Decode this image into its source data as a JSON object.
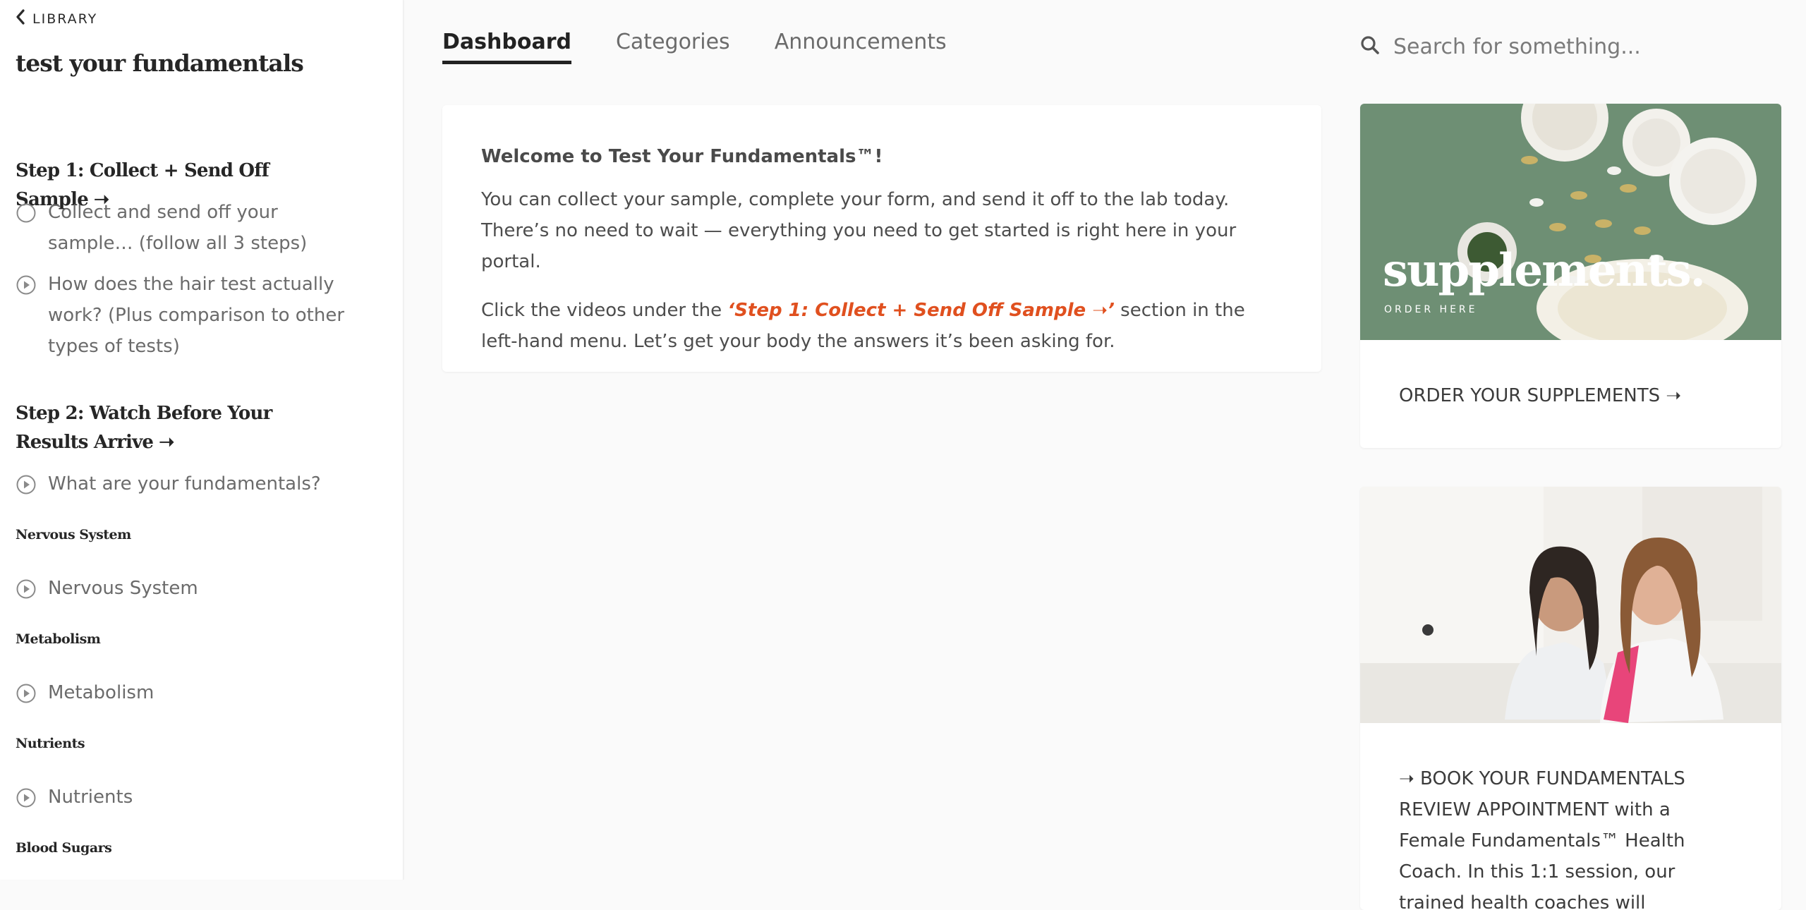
{
  "sidebar": {
    "back_label": "LIBRARY",
    "course_title": "test your fundamentals",
    "step1_title": "Step 1: Collect + Send Off Sample ➝",
    "step1_lessons": [
      {
        "label": "Collect and send off your sample… (follow all 3 steps)",
        "icon": "circle-progress-icon"
      },
      {
        "label": "How does the hair test actually work? (Plus comparison to other types of tests)",
        "icon": "play-circle-icon"
      }
    ],
    "step2_title": "Step 2: Watch Before Your Results Arrive ➝",
    "step2_lessons": [
      {
        "label": "What are your fundamentals?",
        "icon": "play-circle-icon"
      }
    ],
    "nervous_title": "Nervous System",
    "nervous_lesson": "Nervous System",
    "metabolism_title": "Metabolism",
    "metabolism_lesson": "Metabolism",
    "nutrients_title": "Nutrients",
    "nutrients_lesson": "Nutrients",
    "blood_title": "Blood Sugars"
  },
  "tabs": [
    {
      "label": "Dashboard",
      "active": true
    },
    {
      "label": "Categories",
      "active": false
    },
    {
      "label": "Announcements",
      "active": false
    }
  ],
  "search": {
    "placeholder": "Search for something..."
  },
  "welcome": {
    "title": "Welcome to Test Your Fundamentals™!",
    "para1": "You can collect your sample, complete your form, and send it off to the lab today. There’s no need to wait — everything you need to get started is right here in your portal.",
    "para2_before": "Click the videos under the ",
    "para2_highlight": "‘Step 1: Collect + Send Off Sample ➝’",
    "para2_after": " section in the left-hand menu. Let’s get your body the answers it’s been asking for."
  },
  "supplements_card": {
    "image_word": "supplements.",
    "image_sub": "ORDER HERE",
    "link_label": "ORDER YOUR SUPPLEMENTS ➝"
  },
  "coach_card": {
    "text": "➝ BOOK YOUR FUNDAMENTALS REVIEW APPOINTMENT with a Female Fundamentals™ Health Coach. In this 1:1 session, our trained health coaches will"
  },
  "colors": {
    "accent": "#e0501f",
    "text": "#3c3c3c",
    "sidebar_bg": "#ffffff",
    "page_bg": "#fafafa",
    "supp_green": "#6e8f74"
  }
}
